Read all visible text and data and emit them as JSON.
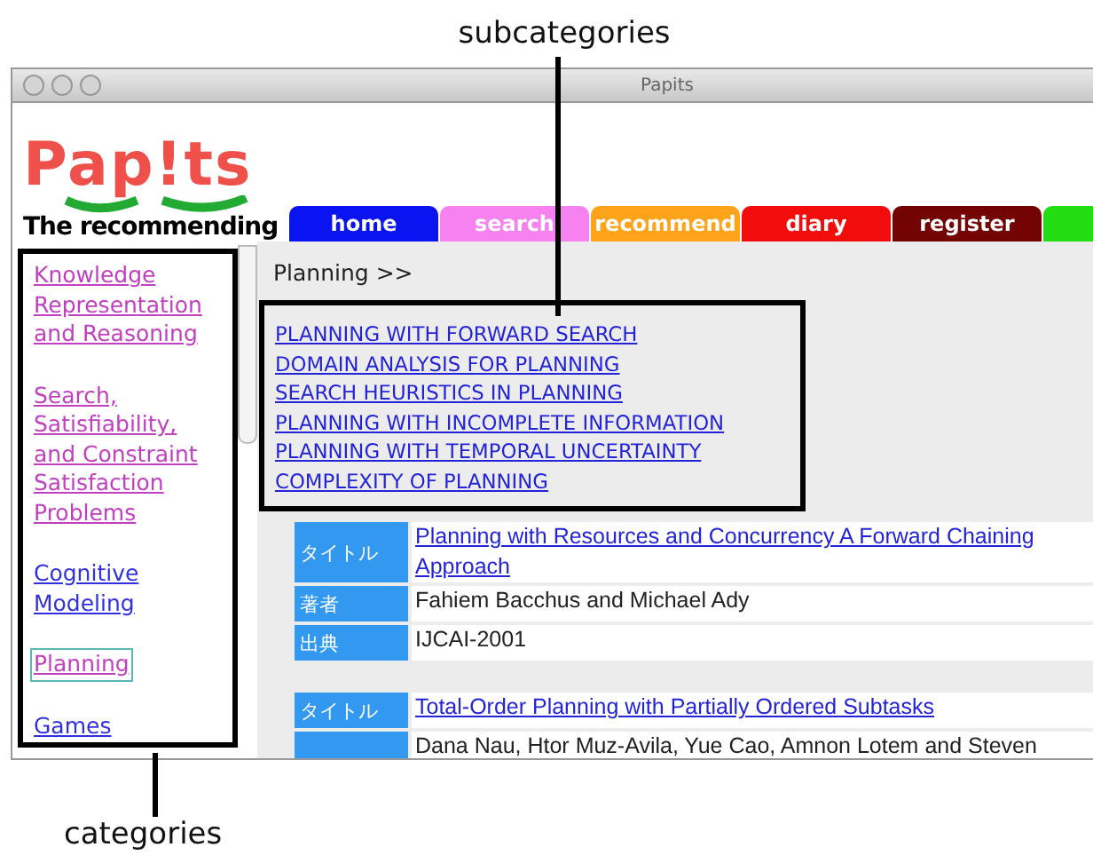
{
  "annotations": {
    "top": "subcategories",
    "bottom": "categories"
  },
  "window": {
    "title": "Papits"
  },
  "logo": {
    "name": "Pap!ts",
    "tagline": "The recommending"
  },
  "tabs": [
    {
      "label": "home",
      "color": "#0a14f0"
    },
    {
      "label": "search",
      "color": "#f582ee"
    },
    {
      "label": "recommend",
      "color": "#ffa41a"
    },
    {
      "label": "diary",
      "color": "#f20c0c"
    },
    {
      "label": "register",
      "color": "#740404"
    },
    {
      "color": "#22dd11"
    }
  ],
  "categories": [
    {
      "label": "Knowledge Representation and Reasoning",
      "visited": true,
      "selected": false
    },
    {
      "label": "Search, Satisfiability, and Constraint Satisfaction Problems",
      "visited": true,
      "selected": false
    },
    {
      "label": "Cognitive Modeling",
      "visited": false,
      "selected": false
    },
    {
      "label": "Planning",
      "visited": true,
      "selected": true
    },
    {
      "label": "Games",
      "visited": false,
      "selected": false
    }
  ],
  "breadcrumb": "Planning >>",
  "subcategories": [
    "PLANNING WITH FORWARD SEARCH",
    "DOMAIN ANALYSIS FOR PLANNING",
    "SEARCH HEURISTICS IN PLANNING",
    "PLANNING WITH INCOMPLETE INFORMATION",
    "PLANNING WITH TEMPORAL UNCERTAINTY",
    "COMPLEXITY OF PLANNING"
  ],
  "papers": [
    {
      "fields": [
        {
          "label": "タイトル",
          "value": "Planning with Resources and Concurrency A Forward Chaining Approach",
          "link": true
        },
        {
          "label": "著者",
          "value": "Fahiem Bacchus and Michael Ady",
          "link": false
        },
        {
          "label": "出典",
          "value": "IJCAI-2001",
          "link": false
        }
      ]
    },
    {
      "fields": [
        {
          "label": "タイトル",
          "value": "Total-Order Planning with Partially Ordered Subtasks",
          "link": true
        },
        {
          "value": "Dana Nau, Htor Muz-Avila, Yue Cao, Amnon Lotem and Steven",
          "link": false
        }
      ]
    }
  ]
}
